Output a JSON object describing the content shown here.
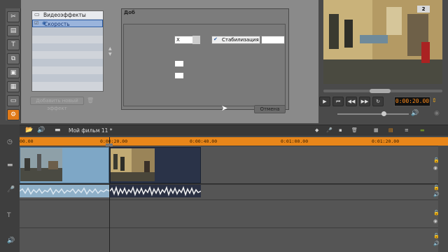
{
  "editor": {
    "effects_header": "Видеоэффекты",
    "effect_selected": "Скорость",
    "add_effect_button": "Добавить новый эффект",
    "dialog_title": "Доб",
    "field_x_label": "X",
    "stabilization_label": "Стабилизация",
    "cancel_button": "Отмена"
  },
  "preview": {
    "badge": "2",
    "timecode": "0:00:20.00"
  },
  "timeline": {
    "movie_title": "Мой фильм 11 *",
    "ruler_ticks": [
      "00.00",
      "0:00:20.00",
      "0:00:40.00",
      "0:01:00.00",
      "0:01:20.00"
    ]
  },
  "colors": {
    "accent": "#e8861a",
    "selection": "#9ab4dc",
    "timecode": "#ff8c1a"
  }
}
